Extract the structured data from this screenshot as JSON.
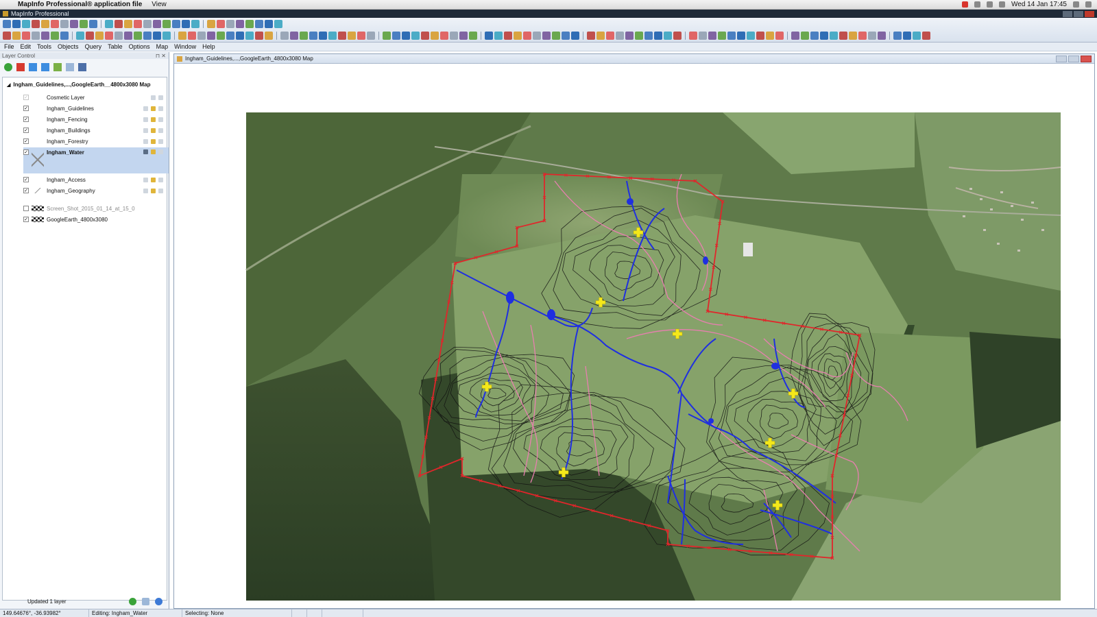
{
  "macbar": {
    "app_name": "MapInfo Professional® application file",
    "menu_view": "View",
    "datetime": "Wed 14 Jan 17:45"
  },
  "window": {
    "title": "MapInfo Professional"
  },
  "menubar": [
    "File",
    "Edit",
    "Tools",
    "Objects",
    "Query",
    "Table",
    "Options",
    "Map",
    "Window",
    "Help"
  ],
  "layer_control": {
    "title": "Layer Control",
    "root": "Ingham_Guidelines,...,GoogleEarth__4800x3080 Map",
    "layers": [
      {
        "name": "Cosmetic Layer",
        "checked": true,
        "dim": true
      },
      {
        "name": "Ingham_Guidelines",
        "checked": true
      },
      {
        "name": "Ingham_Fencing",
        "checked": true
      },
      {
        "name": "Ingham_Buildings",
        "checked": true
      },
      {
        "name": "Ingham_Forestry",
        "checked": true
      },
      {
        "name": "Ingham_Water",
        "checked": true,
        "selected": true
      },
      {
        "name": "Ingham_Access",
        "checked": true
      },
      {
        "name": "Ingham_Geography",
        "checked": true
      },
      {
        "name": "Screen_Shot_2015_01_14_at_15_0",
        "checked": false
      },
      {
        "name": "GoogleEarth_4800x3080",
        "checked": true
      }
    ],
    "status": "Updated 1 layer"
  },
  "map_window": {
    "title": "Ingham_Guidelines,...,GoogleEarth_4800x3080 Map"
  },
  "statusbar": {
    "coords": "149.64676°, -36.93982°",
    "editing": "Editing: Ingham_Water",
    "selecting": "Selecting: None"
  },
  "colors": {
    "boundary": "#e0262b",
    "water": "#1f2fe0",
    "guideline": "#e87fb0",
    "contour": "#111111",
    "marker": "#f4e81a"
  }
}
